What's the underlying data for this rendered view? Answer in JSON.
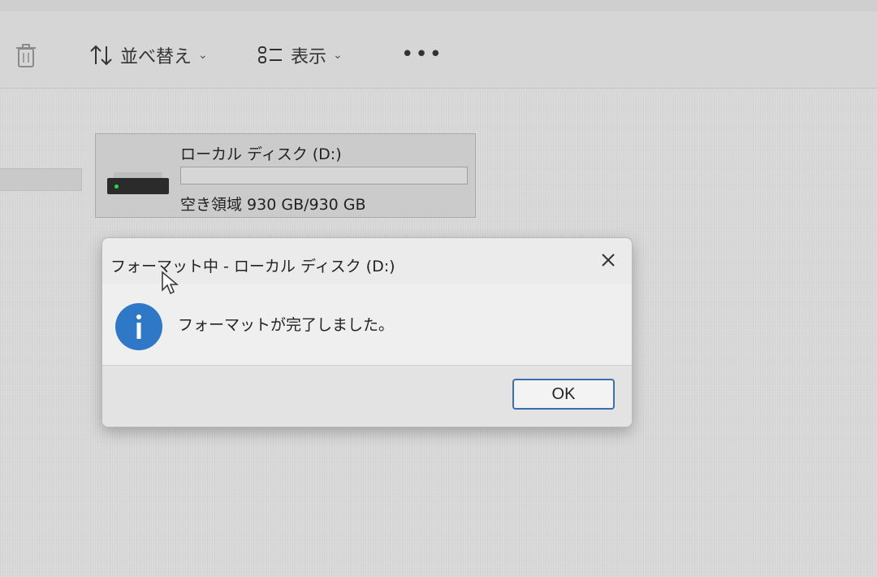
{
  "toolbar": {
    "sort_label": "並べ替え",
    "view_label": "表示",
    "more_label": "•••",
    "chevron": "⌄"
  },
  "drive": {
    "name": "ローカル ディスク (D:)",
    "space": "空き領域 930 GB/930 GB",
    "used_fraction": 0.0
  },
  "dialog": {
    "title": "フォーマット中 - ローカル ディスク (D:)",
    "message": "フォーマットが完了しました。",
    "ok_label": "OK"
  },
  "icons": {
    "delete": "trash-icon",
    "sort": "sort-arrows-icon",
    "view": "view-list-icon",
    "close": "close-icon",
    "info": "info-icon",
    "drive": "hard-drive-icon"
  },
  "colors": {
    "info_blue": "#2f78c8",
    "ok_border": "#3d6fb0",
    "drive_led": "#2fd34a"
  }
}
